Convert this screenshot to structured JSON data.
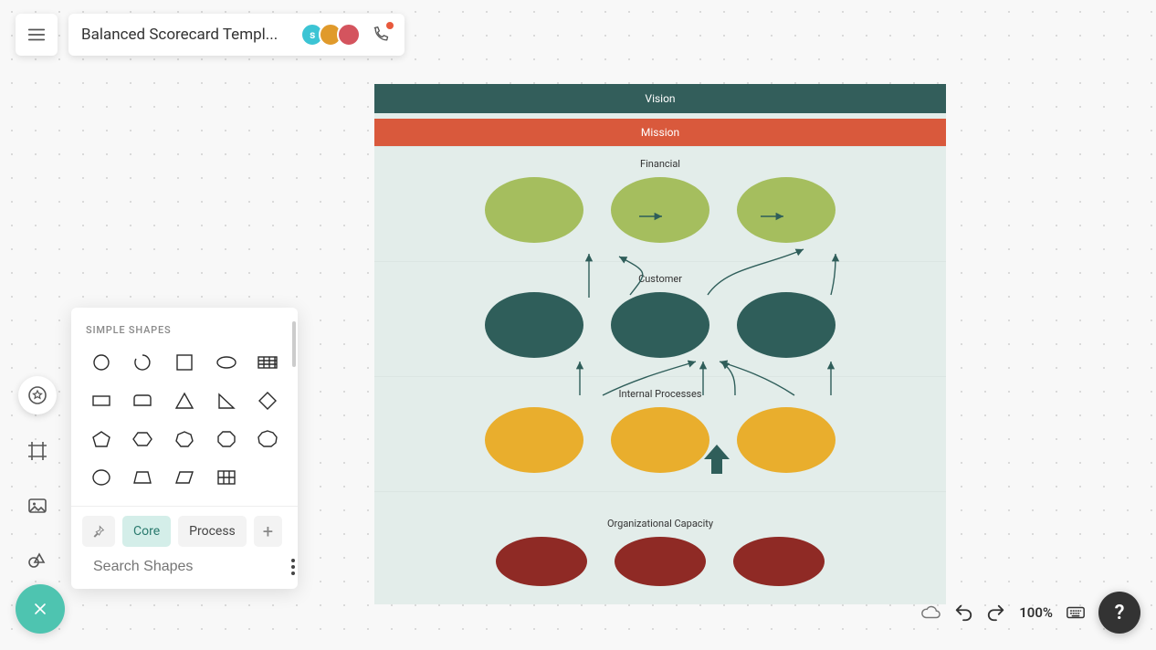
{
  "header": {
    "doc_title": "Balanced Scorecard Templ...",
    "avatars": [
      {
        "label": "s",
        "color": "#3cc4d4"
      },
      {
        "label": "",
        "color": "#e09a2b"
      },
      {
        "label": "",
        "color": "#d4545e"
      }
    ]
  },
  "shapes_panel": {
    "section_title": "SIMPLE SHAPES",
    "tabs": {
      "core": "Core",
      "process": "Process"
    },
    "search_placeholder": "Search Shapes",
    "shapes": [
      "circle",
      "arc",
      "square",
      "ellipse",
      "table",
      "rectangle",
      "card",
      "triangle",
      "right-triangle",
      "diamond",
      "pentagon",
      "hexagon",
      "heptagon",
      "octagon",
      "nonagon",
      "ring",
      "trapezoid",
      "parallelogram",
      "grid",
      "blank"
    ]
  },
  "diagram": {
    "bands": {
      "vision": "Vision",
      "mission": "Mission"
    },
    "sections": {
      "financial": "Financial",
      "customer": "Customer",
      "internal": "Internal Processes",
      "organizational": "Organizational Capacity"
    }
  },
  "statusbar": {
    "zoom": "100%"
  }
}
